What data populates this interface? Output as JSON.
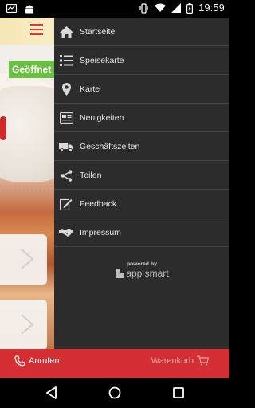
{
  "status_bar": {
    "time": "19:59",
    "left_icons": [
      "notification-icon",
      "android-icon"
    ],
    "right_icons": [
      "vibrate-icon",
      "wifi-icon",
      "signal-icon",
      "battery-icon"
    ]
  },
  "background_app": {
    "status_badge": "Geöffnet",
    "colors": {
      "accent": "#e1373c",
      "badge": "#6bbf44"
    }
  },
  "drawer": {
    "items": [
      {
        "label": "Startseite",
        "icon": "home-icon"
      },
      {
        "label": "Speisekarte",
        "icon": "menu-list-icon"
      },
      {
        "label": "Karte",
        "icon": "map-pin-icon"
      },
      {
        "label": "Neuigkeiten",
        "icon": "newspaper-icon"
      },
      {
        "label": "Geschäftszeiten",
        "icon": "delivery-truck-icon"
      },
      {
        "label": "Teilen",
        "icon": "share-icon"
      },
      {
        "label": "Feedback",
        "icon": "edit-icon"
      },
      {
        "label": "Impressum",
        "icon": "handshake-icon"
      }
    ],
    "powered_by": "powered by",
    "brand": "app smart",
    "colors": {
      "background": "#2c2c2c",
      "divider": "#444444",
      "text": "#e6e6e6"
    }
  },
  "bottom_bar": {
    "call_label": "Anrufen",
    "cart_label": "Warenkorb",
    "colors": {
      "background": "#d42f34"
    }
  },
  "nav_bar": {
    "buttons": [
      "back-icon",
      "home-circle-icon",
      "recents-icon"
    ]
  }
}
